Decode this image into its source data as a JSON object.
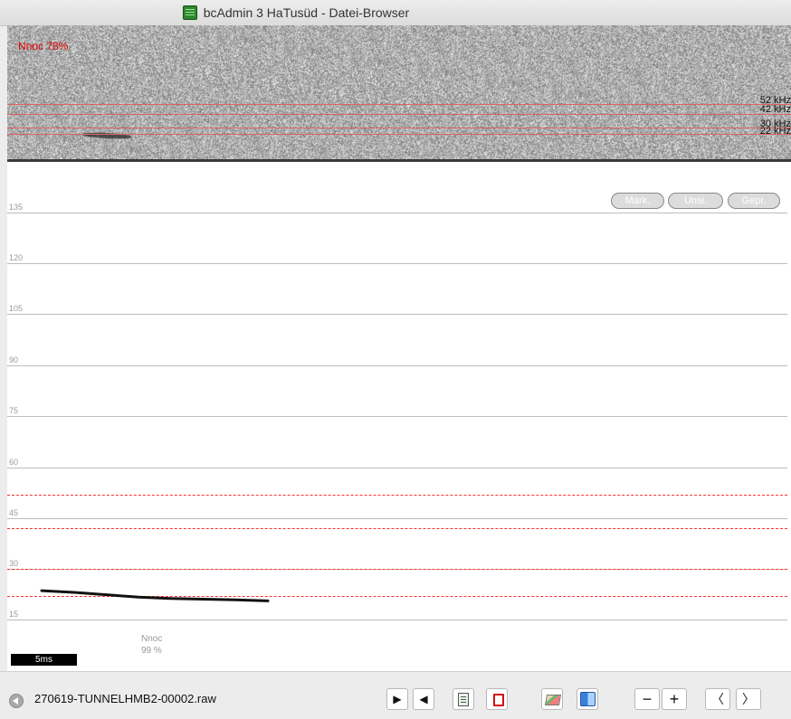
{
  "window": {
    "title": "bcAdmin 3 HaTusüd - Datei-Browser",
    "app_icon": "database-icon"
  },
  "spectrogram": {
    "species_label": "Nnoc 78%",
    "label_color": "#e00000",
    "line_color": "#e06060",
    "freq_markers": [
      "52 kHz",
      "42 kHz",
      "30 kHz",
      "22 kHz"
    ]
  },
  "plot": {
    "y_ticks": [
      "135",
      "120",
      "105",
      "90",
      "75",
      "60",
      "45",
      "30",
      "15"
    ],
    "dashed_color": "#ff3030",
    "buttons": {
      "mark": "Mark.",
      "unsi": "Unsi.",
      "gepr": "Gepr."
    },
    "call_label": {
      "species": "Nnoc",
      "percent": "99 %"
    },
    "scale_bar": "5ms"
  },
  "chart_data": {
    "type": "line",
    "title": "",
    "xlabel": "",
    "ylabel": "",
    "ylim": [
      15,
      135
    ],
    "y_ticks": [
      135,
      120,
      105,
      90,
      75,
      60,
      45,
      30,
      15
    ],
    "reference_lines_khz": [
      52,
      42,
      30,
      22
    ],
    "series": [
      {
        "values": [
          23.5,
          23,
          22.3,
          21.6,
          21.2,
          21,
          20.8,
          20.5
        ]
      }
    ]
  },
  "bottom_bar": {
    "filename": "270619-TUNNELHMB2-00002.raw",
    "buttons": {
      "play": "▶",
      "rewind": "◀",
      "zoom_out": "−",
      "zoom_in": "+",
      "prev": "〈",
      "next": "〉"
    },
    "icons": [
      "play-icon",
      "play-reverse-icon",
      "document-icon",
      "pdf-icon",
      "map-icon",
      "finder-icon",
      "zoom-out-icon",
      "zoom-in-icon",
      "previous-icon",
      "next-icon"
    ]
  }
}
